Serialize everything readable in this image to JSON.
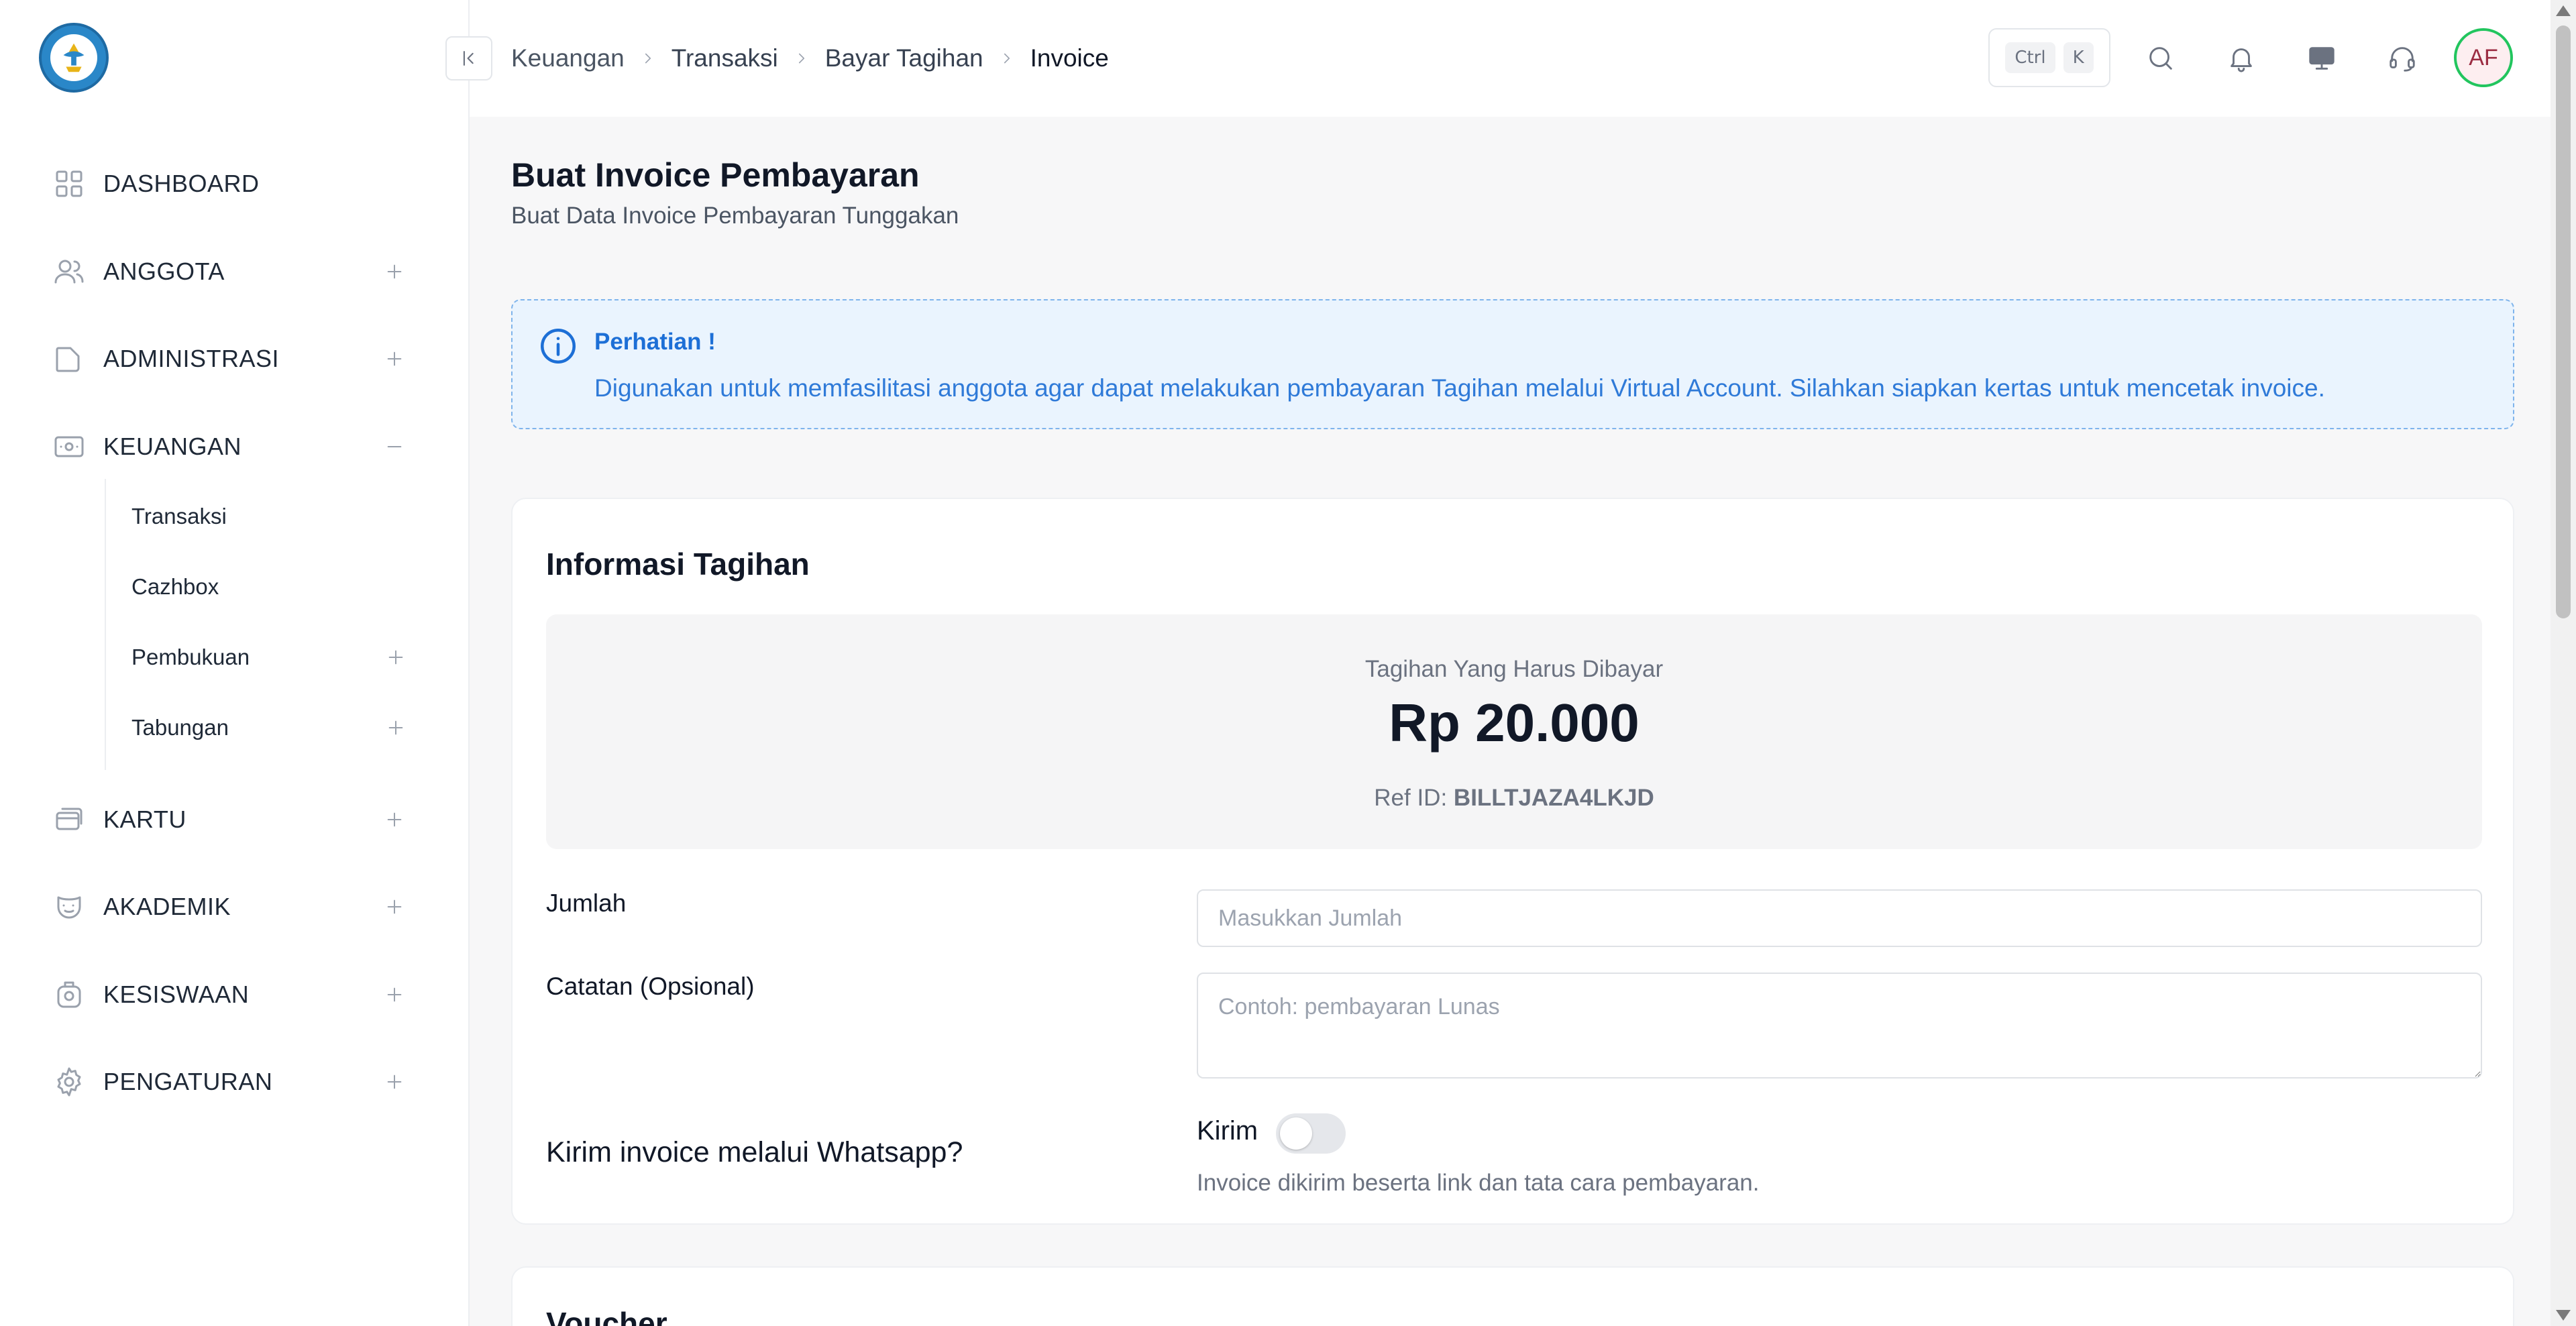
{
  "sidebar": {
    "logo_icon": "tut-wuri-handayani-logo",
    "items": [
      {
        "label": "DASHBOARD",
        "icon": "grid-icon"
      },
      {
        "label": "ANGGOTA",
        "icon": "users-icon"
      },
      {
        "label": "ADMINISTRASI",
        "icon": "folder-icon"
      },
      {
        "label": "KEUANGAN",
        "icon": "money-icon"
      },
      {
        "label": "KARTU",
        "icon": "cards-icon"
      },
      {
        "label": "AKADEMIK",
        "icon": "mask-icon"
      },
      {
        "label": "KESISWAAN",
        "icon": "badge-icon"
      },
      {
        "label": "PENGATURAN",
        "icon": "gear-icon"
      }
    ],
    "keuangan_sub": [
      {
        "label": "Transaksi"
      },
      {
        "label": "Cazhbox"
      },
      {
        "label": "Pembukuan"
      },
      {
        "label": "Tabungan"
      }
    ]
  },
  "topbar": {
    "breadcrumb": [
      "Keuangan",
      "Transaksi",
      "Bayar Tagihan",
      "Invoice"
    ],
    "shortcut": [
      "Ctrl",
      "K"
    ],
    "avatar_initials": "AF"
  },
  "page": {
    "title": "Buat Invoice Pembayaran",
    "subtitle": "Buat Data Invoice Pembayaran Tunggakan"
  },
  "alert": {
    "title": "Perhatian !",
    "text": "Digunakan untuk memfasilitasi anggota agar dapat melakukan pembayaran Tagihan melalui Virtual Account. Silahkan siapkan kertas untuk mencetak invoice.",
    "color": "#1d6fd6"
  },
  "billing": {
    "section_title": "Informasi Tagihan",
    "summary_label": "Tagihan Yang Harus Dibayar",
    "amount": "Rp 20.000",
    "ref_label": "Ref ID:",
    "ref_id": "BILLTJAZA4LKJD",
    "jumlah_label": "Jumlah",
    "jumlah_value": "",
    "jumlah_placeholder": "Masukkan Jumlah",
    "catatan_label": "Catatan (Opsional)",
    "catatan_value": "",
    "catatan_placeholder": "Contoh: pembayaran Lunas",
    "whatsapp_label": "Kirim invoice melalui Whatsapp?",
    "kirim_label": "Kirim",
    "kirim_enabled": false,
    "kirim_help": "Invoice dikirim beserta link dan tata cara pembayaran."
  },
  "voucher": {
    "section_title": "Voucher"
  }
}
